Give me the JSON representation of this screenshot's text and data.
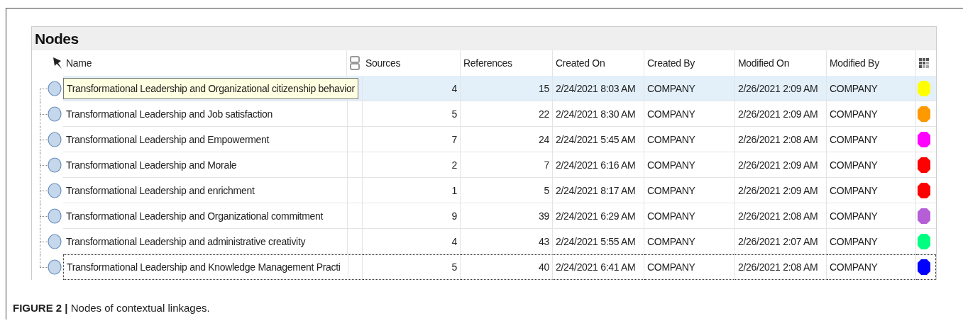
{
  "panel": {
    "title": "Nodes"
  },
  "table": {
    "columns": [
      "Name",
      "Sources",
      "References",
      "Created On",
      "Created By",
      "Modified On",
      "Modified By"
    ],
    "rows": [
      {
        "name": "Transformational Leadership and Organizational citizenship behavior",
        "sources": "4",
        "references": "15",
        "created_on": "2/24/2021 8:03 AM",
        "created_by": "COMPANY",
        "modified_on": "2/26/2021 2:09 AM",
        "modified_by": "COMPANY",
        "color": "#ffff00",
        "selected": true,
        "hovered": true,
        "focused": false
      },
      {
        "name": "Transformational Leadership and Job satisfaction",
        "sources": "5",
        "references": "22",
        "created_on": "2/24/2021 8:30 AM",
        "created_by": "COMPANY",
        "modified_on": "2/26/2021 2:09 AM",
        "modified_by": "COMPANY",
        "color": "#ff9900",
        "selected": false,
        "hovered": false,
        "focused": false
      },
      {
        "name": "Transformational Leadership and Empowerment",
        "sources": "7",
        "references": "24",
        "created_on": "2/24/2021 5:45 AM",
        "created_by": "COMPANY",
        "modified_on": "2/26/2021 2:08 AM",
        "modified_by": "COMPANY",
        "color": "#ff00ff",
        "selected": false,
        "hovered": false,
        "focused": false
      },
      {
        "name": "Transformational Leadership and Morale",
        "sources": "2",
        "references": "7",
        "created_on": "2/24/2021 6:16 AM",
        "created_by": "COMPANY",
        "modified_on": "2/26/2021 2:09 AM",
        "modified_by": "COMPANY",
        "color": "#ff0000",
        "selected": false,
        "hovered": false,
        "focused": false
      },
      {
        "name": "Transformational Leadership and enrichment",
        "sources": "1",
        "references": "5",
        "created_on": "2/24/2021 8:17 AM",
        "created_by": "COMPANY",
        "modified_on": "2/26/2021 2:09 AM",
        "modified_by": "COMPANY",
        "color": "#ff0000",
        "selected": false,
        "hovered": false,
        "focused": false
      },
      {
        "name": "Transformational Leadership and Organizational commitment",
        "sources": "9",
        "references": "39",
        "created_on": "2/24/2021 6:29 AM",
        "created_by": "COMPANY",
        "modified_on": "2/26/2021 2:08 AM",
        "modified_by": "COMPANY",
        "color": "#b65ed6",
        "selected": false,
        "hovered": false,
        "focused": false
      },
      {
        "name": "Transformational Leadership and administrative creativity",
        "sources": "4",
        "references": "43",
        "created_on": "2/24/2021 5:55 AM",
        "created_by": "COMPANY",
        "modified_on": "2/26/2021 2:07 AM",
        "modified_by": "COMPANY",
        "color": "#00ff80",
        "selected": false,
        "hovered": false,
        "focused": false
      },
      {
        "name": "Transformational Leadership and Knowledge Management Practi",
        "sources": "5",
        "references": "40",
        "created_on": "2/24/2021 6:41 AM",
        "created_by": "COMPANY",
        "modified_on": "2/26/2021 2:08 AM",
        "modified_by": "COMPANY",
        "color": "#0000ff",
        "selected": false,
        "hovered": false,
        "focused": true
      }
    ]
  },
  "caption": "**FIGURE 2 |** Nodes of contextual linkages."
}
